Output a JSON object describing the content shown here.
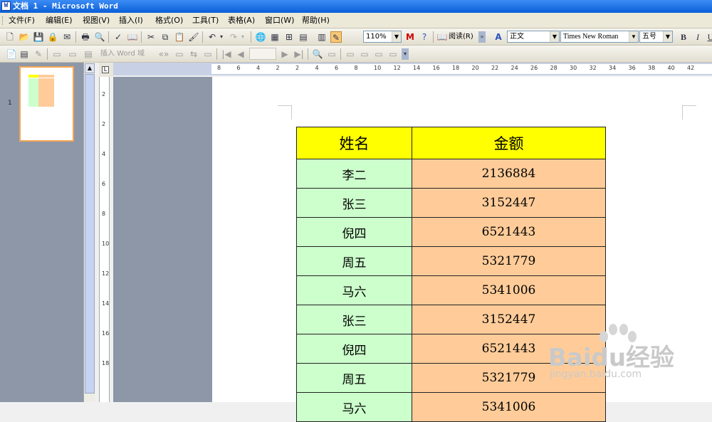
{
  "window": {
    "title": "文档 1 - Microsoft Word"
  },
  "menu": [
    "文件(F)",
    "编辑(E)",
    "视图(V)",
    "插入(I)",
    "格式(O)",
    "工具(T)",
    "表格(A)",
    "窗口(W)",
    "帮助(H)"
  ],
  "toolbar": {
    "zoom": "110%",
    "read_label": "阅读(R)",
    "style": "正文",
    "font": "Times New Roman",
    "size": "五号",
    "bold": "B",
    "italic": "I",
    "underline": "U"
  },
  "toolbar2": {
    "insert_field": "插入 Word 域"
  },
  "thumbnails": {
    "page_number": "1"
  },
  "ruler": {
    "h_ticks": [
      "8",
      "6",
      "4",
      "2",
      "2",
      "4",
      "6",
      "8",
      "10",
      "12",
      "14",
      "16",
      "18",
      "20",
      "22",
      "24",
      "26",
      "28",
      "30",
      "32",
      "34",
      "36",
      "38",
      "40",
      "42"
    ],
    "v_ticks": [
      "2",
      "2",
      "4",
      "6",
      "8",
      "10",
      "12",
      "14",
      "16",
      "18"
    ]
  },
  "table": {
    "headers": [
      "姓名",
      "金额"
    ],
    "rows": [
      [
        "李二",
        "2136884"
      ],
      [
        "张三",
        "3152447"
      ],
      [
        "倪四",
        "6521443"
      ],
      [
        "周五",
        "5321779"
      ],
      [
        "马六",
        "5341006"
      ],
      [
        "张三",
        "3152447"
      ],
      [
        "倪四",
        "6521443"
      ],
      [
        "周五",
        "5321779"
      ],
      [
        "马六",
        "5341006"
      ]
    ],
    "colors": {
      "header": "#ffff00",
      "name_col": "#ccffcc",
      "amount_col": "#ffcc99"
    }
  },
  "watermark": {
    "brand": "Baidu经验",
    "url": "jingyan.baidu.com"
  }
}
